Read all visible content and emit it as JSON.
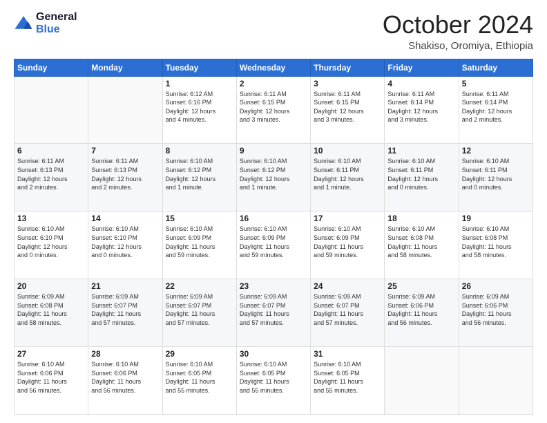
{
  "header": {
    "logo_line1": "General",
    "logo_line2": "Blue",
    "month_title": "October 2024",
    "location": "Shakiso, Oromiya, Ethiopia"
  },
  "weekdays": [
    "Sunday",
    "Monday",
    "Tuesday",
    "Wednesday",
    "Thursday",
    "Friday",
    "Saturday"
  ],
  "weeks": [
    [
      {
        "day": "",
        "info": ""
      },
      {
        "day": "",
        "info": ""
      },
      {
        "day": "1",
        "info": "Sunrise: 6:12 AM\nSunset: 6:16 PM\nDaylight: 12 hours\nand 4 minutes."
      },
      {
        "day": "2",
        "info": "Sunrise: 6:11 AM\nSunset: 6:15 PM\nDaylight: 12 hours\nand 3 minutes."
      },
      {
        "day": "3",
        "info": "Sunrise: 6:11 AM\nSunset: 6:15 PM\nDaylight: 12 hours\nand 3 minutes."
      },
      {
        "day": "4",
        "info": "Sunrise: 6:11 AM\nSunset: 6:14 PM\nDaylight: 12 hours\nand 3 minutes."
      },
      {
        "day": "5",
        "info": "Sunrise: 6:11 AM\nSunset: 6:14 PM\nDaylight: 12 hours\nand 2 minutes."
      }
    ],
    [
      {
        "day": "6",
        "info": "Sunrise: 6:11 AM\nSunset: 6:13 PM\nDaylight: 12 hours\nand 2 minutes."
      },
      {
        "day": "7",
        "info": "Sunrise: 6:11 AM\nSunset: 6:13 PM\nDaylight: 12 hours\nand 2 minutes."
      },
      {
        "day": "8",
        "info": "Sunrise: 6:10 AM\nSunset: 6:12 PM\nDaylight: 12 hours\nand 1 minute."
      },
      {
        "day": "9",
        "info": "Sunrise: 6:10 AM\nSunset: 6:12 PM\nDaylight: 12 hours\nand 1 minute."
      },
      {
        "day": "10",
        "info": "Sunrise: 6:10 AM\nSunset: 6:11 PM\nDaylight: 12 hours\nand 1 minute."
      },
      {
        "day": "11",
        "info": "Sunrise: 6:10 AM\nSunset: 6:11 PM\nDaylight: 12 hours\nand 0 minutes."
      },
      {
        "day": "12",
        "info": "Sunrise: 6:10 AM\nSunset: 6:11 PM\nDaylight: 12 hours\nand 0 minutes."
      }
    ],
    [
      {
        "day": "13",
        "info": "Sunrise: 6:10 AM\nSunset: 6:10 PM\nDaylight: 12 hours\nand 0 minutes."
      },
      {
        "day": "14",
        "info": "Sunrise: 6:10 AM\nSunset: 6:10 PM\nDaylight: 12 hours\nand 0 minutes."
      },
      {
        "day": "15",
        "info": "Sunrise: 6:10 AM\nSunset: 6:09 PM\nDaylight: 11 hours\nand 59 minutes."
      },
      {
        "day": "16",
        "info": "Sunrise: 6:10 AM\nSunset: 6:09 PM\nDaylight: 11 hours\nand 59 minutes."
      },
      {
        "day": "17",
        "info": "Sunrise: 6:10 AM\nSunset: 6:09 PM\nDaylight: 11 hours\nand 59 minutes."
      },
      {
        "day": "18",
        "info": "Sunrise: 6:10 AM\nSunset: 6:08 PM\nDaylight: 11 hours\nand 58 minutes."
      },
      {
        "day": "19",
        "info": "Sunrise: 6:10 AM\nSunset: 6:08 PM\nDaylight: 11 hours\nand 58 minutes."
      }
    ],
    [
      {
        "day": "20",
        "info": "Sunrise: 6:09 AM\nSunset: 6:08 PM\nDaylight: 11 hours\nand 58 minutes."
      },
      {
        "day": "21",
        "info": "Sunrise: 6:09 AM\nSunset: 6:07 PM\nDaylight: 11 hours\nand 57 minutes."
      },
      {
        "day": "22",
        "info": "Sunrise: 6:09 AM\nSunset: 6:07 PM\nDaylight: 11 hours\nand 57 minutes."
      },
      {
        "day": "23",
        "info": "Sunrise: 6:09 AM\nSunset: 6:07 PM\nDaylight: 11 hours\nand 57 minutes."
      },
      {
        "day": "24",
        "info": "Sunrise: 6:09 AM\nSunset: 6:07 PM\nDaylight: 11 hours\nand 57 minutes."
      },
      {
        "day": "25",
        "info": "Sunrise: 6:09 AM\nSunset: 6:06 PM\nDaylight: 11 hours\nand 56 minutes."
      },
      {
        "day": "26",
        "info": "Sunrise: 6:09 AM\nSunset: 6:06 PM\nDaylight: 11 hours\nand 56 minutes."
      }
    ],
    [
      {
        "day": "27",
        "info": "Sunrise: 6:10 AM\nSunset: 6:06 PM\nDaylight: 11 hours\nand 56 minutes."
      },
      {
        "day": "28",
        "info": "Sunrise: 6:10 AM\nSunset: 6:06 PM\nDaylight: 11 hours\nand 56 minutes."
      },
      {
        "day": "29",
        "info": "Sunrise: 6:10 AM\nSunset: 6:05 PM\nDaylight: 11 hours\nand 55 minutes."
      },
      {
        "day": "30",
        "info": "Sunrise: 6:10 AM\nSunset: 6:05 PM\nDaylight: 11 hours\nand 55 minutes."
      },
      {
        "day": "31",
        "info": "Sunrise: 6:10 AM\nSunset: 6:05 PM\nDaylight: 11 hours\nand 55 minutes."
      },
      {
        "day": "",
        "info": ""
      },
      {
        "day": "",
        "info": ""
      }
    ]
  ]
}
